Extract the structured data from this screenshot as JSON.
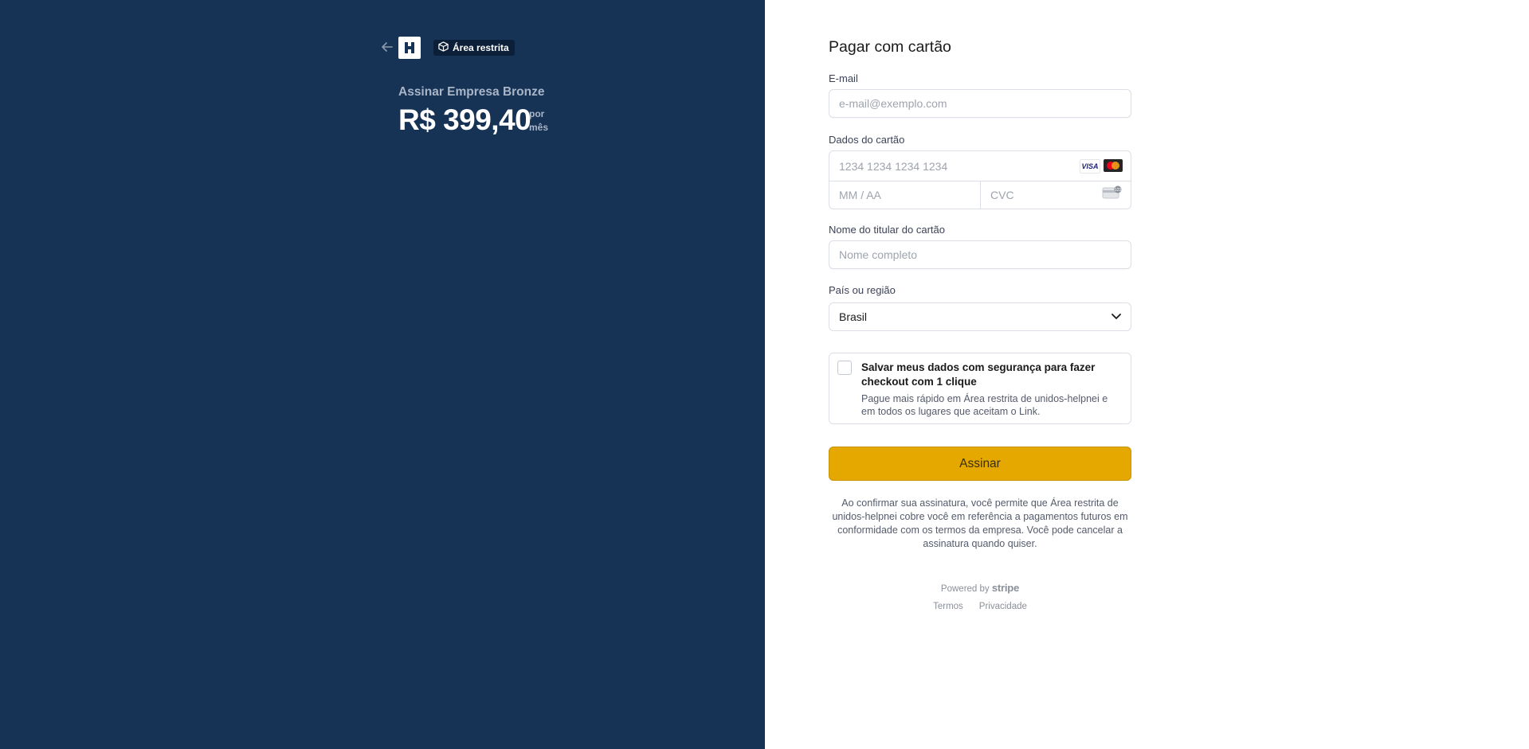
{
  "header": {
    "badge_label": "Área restrita"
  },
  "product": {
    "name": "Assinar Empresa Bronze",
    "price": "R$ 399,40",
    "period_line1": "por",
    "period_line2": "mês"
  },
  "form": {
    "title": "Pagar com cartão",
    "email_label": "E-mail",
    "email_placeholder": "e-mail@exemplo.com",
    "card_label": "Dados do cartão",
    "card_number_placeholder": "1234 1234 1234 1234",
    "card_brand_visa": "VISA",
    "expiry_placeholder": "MM / AA",
    "cvc_placeholder": "CVC",
    "name_label": "Nome do titular do cartão",
    "name_placeholder": "Nome completo",
    "country_label": "País ou região",
    "country_value": "Brasil",
    "save_title": "Salvar meus dados com segurança para fazer checkout com 1 clique",
    "save_desc": "Pague mais rápido em Área restrita de unidos-helpnei e em todos os lugares que aceitam o Link.",
    "submit_label": "Assinar",
    "legal_text": "Ao confirmar sua assinatura, você permite que Área restrita de unidos-helpnei cobre você em referência a pagamentos futuros em conformidade com os termos da empresa. Você pode cancelar a assinatura quando quiser."
  },
  "footer": {
    "powered_prefix": "Powered by",
    "powered_brand": "stripe",
    "terms": "Termos",
    "privacy": "Privacidade"
  },
  "icons": {
    "back": "arrow-left-icon",
    "logo": "helpnei-logo",
    "badge": "cube-icon",
    "select": "chevron-down-icon",
    "cvc": "card-cvc-icon"
  },
  "colors": {
    "left_panel_bg": "#163255",
    "submit_bg": "#e4a800"
  }
}
